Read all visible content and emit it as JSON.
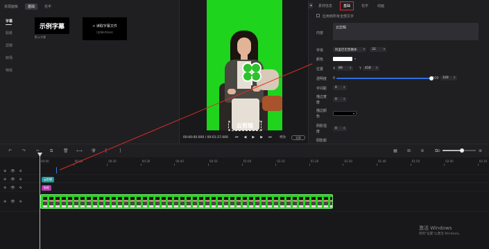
{
  "app": {
    "window_title": "资源面板"
  },
  "left_panel": {
    "tabs": [
      {
        "label": "基础"
      },
      {
        "label": "花字"
      }
    ],
    "sidebar": [
      {
        "label": "字幕"
      },
      {
        "label": "贴纸"
      },
      {
        "label": "滤镜"
      },
      {
        "label": "转场"
      },
      {
        "label": "特效"
      }
    ],
    "caption_card": {
      "preview_text": "示例字幕",
      "name": "默认字幕"
    },
    "import_card": {
      "label": "+ 读取字幕文件",
      "sub": "（支持srt/ass）"
    }
  },
  "preview": {
    "caption_text": "云剪辑",
    "timecode": "00:00:00.000 / 00:01:27.000",
    "controls": [
      "⏮",
      "◀",
      "▶",
      "▶",
      "⏭"
    ],
    "fx_label": "特效",
    "fullscreen_label": "全屏"
  },
  "right_panel": {
    "tabs": [
      {
        "label": "素材信息"
      },
      {
        "label": "基础"
      },
      {
        "label": "花字"
      },
      {
        "label": "动画"
      }
    ],
    "apply_all_label": "应用到所有全部文字",
    "content_label": "内容",
    "content_value": "云剪辑",
    "font_label": "字体",
    "font_value": "阿里巴巴普惠体",
    "font_size": "32",
    "color_label": "颜色",
    "color_value": "#ffffff",
    "position_label": "位置",
    "x_label": "X",
    "x_value": "89",
    "y_label": "Y",
    "y_value": "418",
    "opacity_label": "透明度",
    "opacity_min": "0",
    "opacity_max": "100",
    "opacity_value": "100",
    "spacing_label": "字间距",
    "spacing_value": "0",
    "stroke_width_label": "描边宽度",
    "stroke_width_value": "0",
    "stroke_color_label": "描边颜色",
    "shadow_label": "阴影强度",
    "shadow_value": "0",
    "shadow_color_label": "阴影颜"
  },
  "toolbar": {
    "tools": [
      "↶",
      "↷",
      "✂",
      "⧉",
      "🗑",
      "⟷",
      "🛡",
      "[",
      "]"
    ],
    "right_icons": [
      "▦",
      "⊞",
      "⧈",
      "⧉",
      "⊖",
      "⊕"
    ],
    "zoom_level": 0.58
  },
  "timeline": {
    "ruler": [
      "00:00",
      "00:10",
      "00:20",
      "00:30",
      "00:40",
      "00:50",
      "01:00",
      "01:10",
      "01:20",
      "01:30",
      "01:40",
      "01:50",
      "02:00",
      "02:10"
    ],
    "track_icons": [
      "⊕",
      "👁",
      "✣"
    ],
    "clips": {
      "caption": "云剪辑",
      "sticker": "贴纸"
    }
  },
  "watermark": {
    "title": "激活 Windows",
    "sub": "转到\"设置\"以激活 Windows。"
  }
}
